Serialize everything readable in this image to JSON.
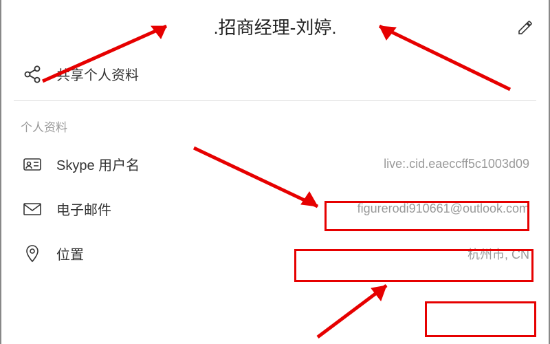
{
  "header": {
    "title": ".招商经理-刘婷."
  },
  "share": {
    "label": "共享个人资料"
  },
  "section": {
    "label": "个人资料"
  },
  "rows": {
    "skype": {
      "label": "Skype 用户名",
      "value": "live:.cid.eaeccff5c1003d09"
    },
    "email": {
      "label": "电子邮件",
      "value": "figurerodi910661@outlook.com"
    },
    "location": {
      "label": "位置",
      "value": "杭州市, CN"
    }
  }
}
